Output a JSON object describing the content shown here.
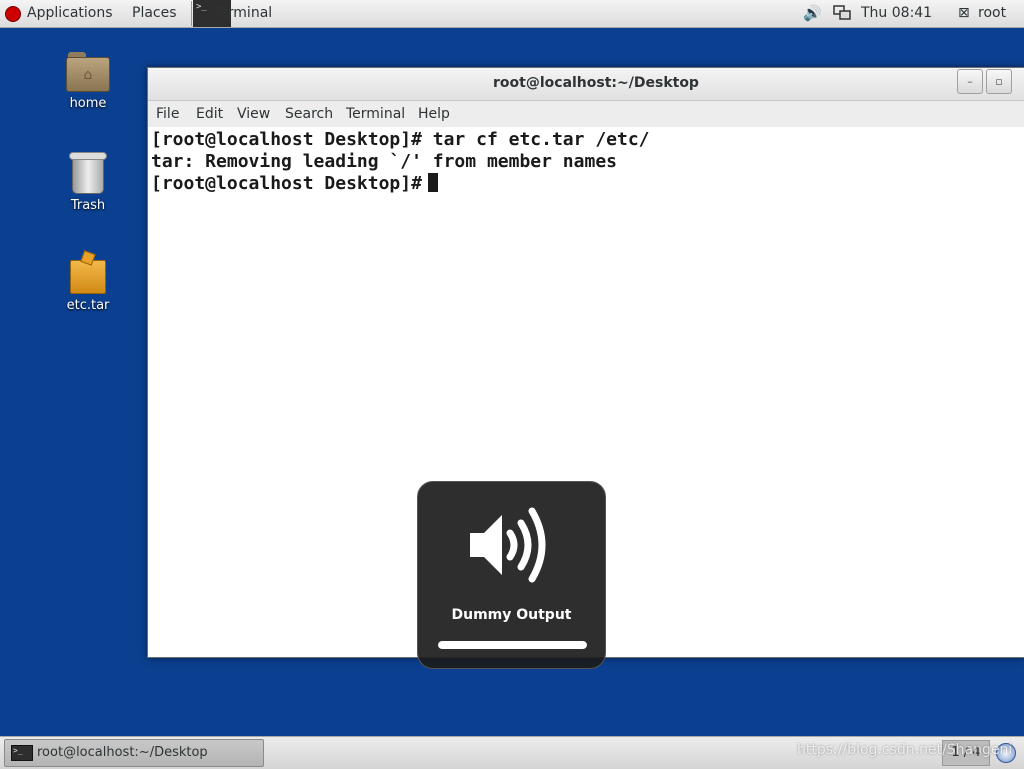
{
  "top_panel": {
    "applications": "Applications",
    "places": "Places",
    "terminal": "Terminal",
    "clock": "Thu 08:41",
    "user": "root"
  },
  "desktop_icons": [
    {
      "label": "home",
      "icon": "folder-home-icon"
    },
    {
      "label": "Trash",
      "icon": "trash-icon"
    },
    {
      "label": "etc.tar",
      "icon": "archive-icon"
    }
  ],
  "window": {
    "title": "root@localhost:~/Desktop",
    "menu": [
      "File",
      "Edit",
      "View",
      "Search",
      "Terminal",
      "Help"
    ],
    "lines": [
      "[root@localhost Desktop]# tar cf etc.tar /etc/",
      "tar: Removing leading `/' from member names",
      "[root@localhost Desktop]#"
    ]
  },
  "osd": {
    "label": "Dummy Output",
    "volume_level": 1.0
  },
  "bottom_panel": {
    "task": "root@localhost:~/Desktop",
    "workspace": "1 / 4",
    "watermark": "https://blog.csdn.net/Shangeni"
  },
  "colors": {
    "desktop_bg": "#0b3f8f",
    "osd_bg": "#1c1c1c"
  }
}
